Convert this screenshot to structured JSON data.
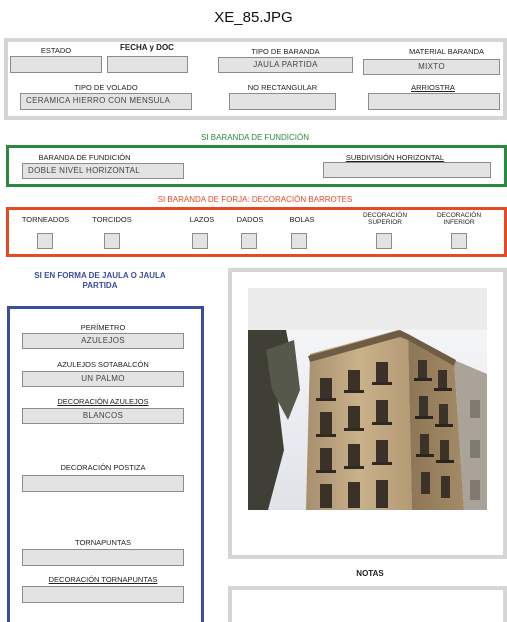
{
  "title": "XE_85.JPG",
  "general": {
    "estado_label": "ESTADO",
    "estado_value": "",
    "fecha_label": "FECHA y DOC",
    "fecha_value": "",
    "tipo_baranda_label": "TIPO DE BARANDA",
    "tipo_baranda_value": "JAULA PARTIDA",
    "material_label": "MATERIAL BARANDA",
    "material_value": "MIXTO",
    "tipo_volado_label": "TIPO DE VOLADO",
    "tipo_volado_value": "CERAMICA HIERRO CON MENSULA",
    "no_rect_label": "NO RECTANGULAR",
    "no_rect_value": "",
    "arriostra_label": "ARRIOSTRA",
    "arriostra_value": ""
  },
  "fundicion": {
    "heading": "SI BARANDA DE FUNDICIÓN",
    "baranda_label": "BARANDA DE FUNDICIÓN",
    "baranda_value": "DOBLE NIVEL HORIZONTAL",
    "subdivision_label": "SUBDIVISIÓN HORIZONTAL",
    "subdivision_value": ""
  },
  "forja": {
    "heading": "SI BARANDA DE FORJA: DECORACIÓN BARROTES",
    "items": [
      {
        "label": "TORNEADOS"
      },
      {
        "label": "TORCIDOS"
      },
      {
        "label": "LAZOS"
      },
      {
        "label": "DADOS"
      },
      {
        "label": "BOLAS"
      },
      {
        "label": "DECORACIÓN\nSUPERIOR"
      },
      {
        "label": "DECORACIÓN\nINFERIOR"
      }
    ]
  },
  "jaula": {
    "heading": "SI EN FORMA DE JAULA O JAULA PARTIDA",
    "perimetro_label": "PERÍMETRO",
    "perimetro_value": "AZULEJOS",
    "sotabalcon_label": "AZULEJOS SOTABALCÓN",
    "sotabalcon_value": "UN PALMO",
    "decoracion_label": "DECORACIÓN AZULEJOS",
    "decoracion_value": "BLANCOS",
    "postiza_label": "DECORACIÓN POSTIZA",
    "postiza_value": "",
    "tornapuntas_label": "TORNAPUNTAS",
    "tornapuntas_value": "",
    "dec_tornapuntas_label": "DECORACIÓN TORNAPUNTAS",
    "dec_tornapuntas_value": ""
  },
  "notas": {
    "label": "NOTAS",
    "value": ""
  },
  "colors": {
    "green": "#2a8a3c",
    "red": "#e64a24",
    "blue": "#3a4ea0",
    "field_bg": "#e3e3e3"
  }
}
